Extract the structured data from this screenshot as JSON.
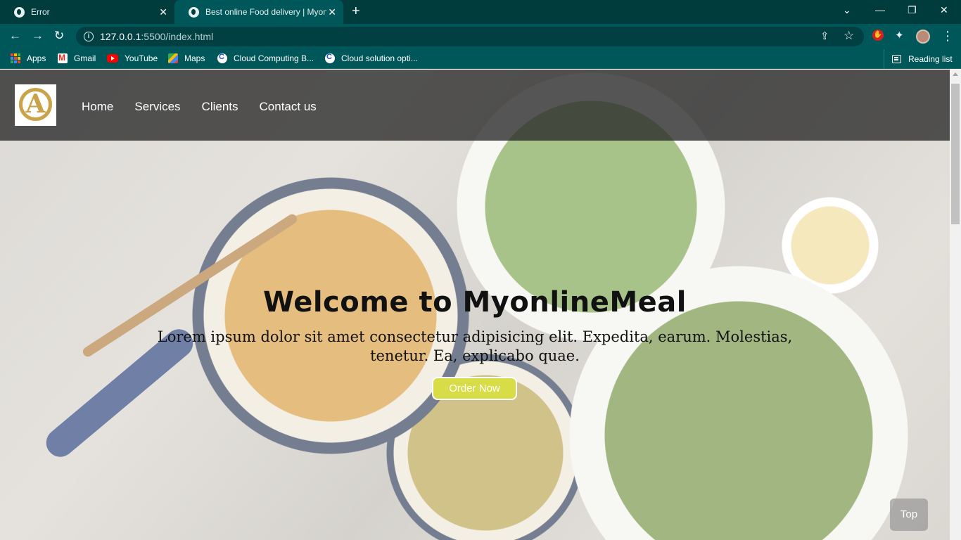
{
  "browser": {
    "tabs": [
      {
        "title": "Error",
        "close": "✕"
      },
      {
        "title": "Best online Food delivery | Myonline",
        "close": "✕"
      }
    ],
    "new_tab": "+",
    "window_controls": {
      "dropdown": "⌄",
      "minimize": "—",
      "restore": "❐",
      "close": "✕"
    },
    "nav": {
      "back": "←",
      "forward": "→",
      "reload": "↻"
    },
    "url": {
      "host": "127.0.0.1",
      "path": ":5500/index.html"
    },
    "toolbar_icons": {
      "share": "⇪",
      "star": "☆",
      "extension_ublock": "✋",
      "puzzle": "✦",
      "menu": "⋮"
    },
    "bookmarks": [
      {
        "label": "Apps",
        "icon": "apps-grid-icon"
      },
      {
        "label": "Gmail",
        "icon": "gmail-icon"
      },
      {
        "label": "YouTube",
        "icon": "youtube-icon"
      },
      {
        "label": "Maps",
        "icon": "maps-icon"
      },
      {
        "label": "Cloud Computing B...",
        "icon": "c-icon"
      },
      {
        "label": "Cloud solution opti...",
        "icon": "c-icon"
      }
    ],
    "reading_list": "Reading list",
    "theme_color": "#00575a"
  },
  "site": {
    "logo_letter": "A",
    "nav_links": [
      "Home",
      "Services",
      "Clients",
      "Contact us"
    ],
    "hero_title": "Welcome to MyonlineMeal",
    "hero_text": "Lorem ipsum dolor sit amet consectetur adipisicing elit. Expedita, earum. Molestias, tenetur. Ea, explicabo quae.",
    "order_button": "Order Now",
    "top_button": "Top",
    "accent_color": "#d8dc46"
  }
}
